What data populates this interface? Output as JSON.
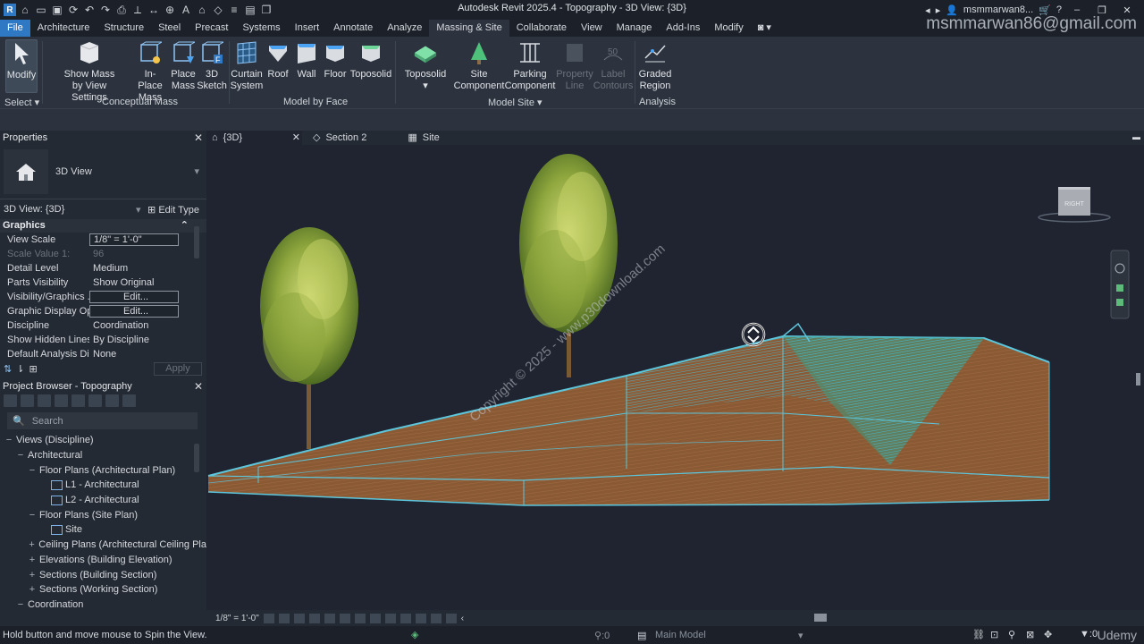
{
  "window": {
    "title": "Autodesk Revit 2025.4 - Topography - 3D View: {3D}",
    "user": "msmmarwan8...",
    "watermark_email": "msmmarwan86@gmail.com"
  },
  "tabs": [
    "File",
    "Architecture",
    "Structure",
    "Steel",
    "Precast",
    "Systems",
    "Insert",
    "Annotate",
    "Analyze",
    "Massing & Site",
    "Collaborate",
    "View",
    "Manage",
    "Add-Ins",
    "Modify"
  ],
  "active_tab": "Massing & Site",
  "ribbon": {
    "modify": "Modify",
    "select": "Select",
    "show_mass_1": "Show Mass",
    "show_mass_2": "by View Settings",
    "inplace_1": "In-Place",
    "inplace_2": "Mass",
    "place_1": "Place",
    "place_2": "Mass",
    "sketch_1": "3D",
    "sketch_2": "Sketch",
    "curtain_1": "Curtain",
    "curtain_2": "System",
    "roof": "Roof",
    "wall": "Wall",
    "floor": "Floor",
    "toposolid_face": "Toposolid",
    "toposolid": "Toposolid",
    "site_1": "Site",
    "site_2": "Component",
    "parking_1": "Parking",
    "parking_2": "Component",
    "property_1": "Property",
    "property_2": "Line",
    "label_1": "Label",
    "label_2": "Contours",
    "graded_1": "Graded",
    "graded_2": "Region",
    "panel_conceptual": "Conceptual Mass",
    "panel_modelbyface": "Model by Face",
    "panel_modelsite": "Model Site",
    "panel_analysis": "Analysis"
  },
  "properties": {
    "header": "Properties",
    "type_name": "3D View",
    "instance": "3D View: {3D}",
    "edit_type": "Edit Type",
    "group": "Graphics",
    "rows": [
      {
        "k": "View Scale",
        "v": "1/8\" = 1'-0\"",
        "box": true
      },
      {
        "k": "Scale Value   1:",
        "v": "96",
        "dim": true
      },
      {
        "k": "Detail Level",
        "v": "Medium"
      },
      {
        "k": "Parts Visibility",
        "v": "Show Original"
      },
      {
        "k": "Visibility/Graphics ...",
        "v": "Edit...",
        "box": true,
        "center": true
      },
      {
        "k": "Graphic Display Op...",
        "v": "Edit...",
        "box": true,
        "center": true
      },
      {
        "k": "Discipline",
        "v": "Coordination"
      },
      {
        "k": "Show Hidden Lines",
        "v": "By Discipline"
      },
      {
        "k": "Default Analysis Dis...",
        "v": "None"
      }
    ],
    "apply": "Apply"
  },
  "browser": {
    "header": "Project Browser - Topography",
    "search_placeholder": "Search",
    "items": [
      {
        "indent": 0,
        "glyph": "−",
        "label": "Views (Discipline)",
        "icon": false
      },
      {
        "indent": 1,
        "glyph": "−",
        "label": "Architectural",
        "icon": false
      },
      {
        "indent": 2,
        "glyph": "−",
        "label": "Floor Plans (Architectural Plan)",
        "icon": false
      },
      {
        "indent": 3,
        "glyph": "",
        "label": "L1 - Architectural",
        "icon": true
      },
      {
        "indent": 3,
        "glyph": "",
        "label": "L2 - Architectural",
        "icon": true
      },
      {
        "indent": 2,
        "glyph": "−",
        "label": "Floor Plans (Site Plan)",
        "icon": false
      },
      {
        "indent": 3,
        "glyph": "",
        "label": "Site",
        "icon": true
      },
      {
        "indent": 2,
        "glyph": "+",
        "label": "Ceiling Plans (Architectural Ceiling Pla",
        "icon": false
      },
      {
        "indent": 2,
        "glyph": "+",
        "label": "Elevations (Building Elevation)",
        "icon": false
      },
      {
        "indent": 2,
        "glyph": "+",
        "label": "Sections (Building Section)",
        "icon": false
      },
      {
        "indent": 2,
        "glyph": "+",
        "label": "Sections (Working Section)",
        "icon": false
      },
      {
        "indent": 1,
        "glyph": "−",
        "label": "Coordination",
        "icon": false
      }
    ]
  },
  "view_tabs": [
    "{3D}",
    "Section 2",
    "Site"
  ],
  "viewcube_label": "RIGHT",
  "view_watermark": "Copyright © 2025 - www.p30download.com",
  "view_scale": "1/8\" = 1'-0\"",
  "status": {
    "hint": "Hold button and move mouse to Spin the View.",
    "zero1": ":0",
    "model": "Main Model",
    "zero2": ":0",
    "brand": "Udemy"
  }
}
